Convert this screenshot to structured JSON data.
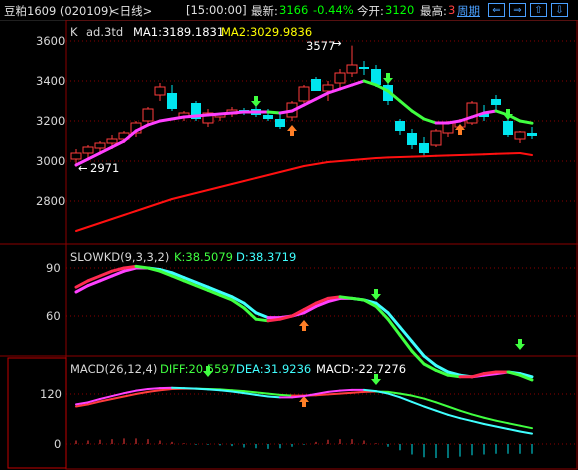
{
  "header": {
    "symbol": "豆粕1609 (020109)",
    "period_tag": "<日线>",
    "time": "[15:00:00]",
    "price_label": "最新:",
    "price": "3166",
    "change": "-0.44%",
    "open_label": "今开:",
    "open": "3120",
    "high_label": "最高:",
    "high": "3",
    "period_link": "周期",
    "nav_buttons": [
      "⇐",
      "⇒",
      "⇧",
      "⇩"
    ]
  },
  "main_panel": {
    "name": "K",
    "study": "ad.3td",
    "ma1_label": "MA1:3189.1831",
    "ma2_label": "MA2:3029.9836",
    "y_ticks": [
      "3600",
      "3400",
      "3200",
      "3000",
      "2800"
    ],
    "high_marker": "3577",
    "low_marker": "2971"
  },
  "kd_panel": {
    "title": "SLOWKD(9,3,3,2)",
    "k_label": "K:38.5079",
    "d_label": "D:38.3719",
    "y_ticks": [
      "90",
      "60"
    ]
  },
  "macd_panel": {
    "title": "MACD(26,12,4)",
    "diff_label": "DIFF:20.5597",
    "dea_label": "DEA:31.9236",
    "macd_label": "MACD:-22.7276",
    "y_ticks": [
      "120",
      "0"
    ]
  },
  "colors": {
    "up": "#ff3c3c",
    "down": "#00e5ee",
    "ma_up": "#ff40ff",
    "ma_down": "#40ff40",
    "ma_long": "#ff1010",
    "kd_k": "#ff2a50",
    "kd_d": "#40ffff",
    "grid": "#8b0000",
    "axis_text": "#d8d8d8"
  },
  "candles": [
    {
      "o": 3010,
      "h": 3060,
      "l": 2971,
      "c": 3040
    },
    {
      "o": 3040,
      "h": 3080,
      "l": 3010,
      "c": 3070
    },
    {
      "o": 3065,
      "h": 3100,
      "l": 3040,
      "c": 3090
    },
    {
      "o": 3090,
      "h": 3130,
      "l": 3060,
      "c": 3110
    },
    {
      "o": 3110,
      "h": 3150,
      "l": 3090,
      "c": 3140
    },
    {
      "o": 3140,
      "h": 3200,
      "l": 3120,
      "c": 3190
    },
    {
      "o": 3200,
      "h": 3270,
      "l": 3180,
      "c": 3260
    },
    {
      "o": 3330,
      "h": 3390,
      "l": 3300,
      "c": 3370
    },
    {
      "o": 3340,
      "h": 3380,
      "l": 3250,
      "c": 3260
    },
    {
      "o": 3220,
      "h": 3250,
      "l": 3200,
      "c": 3240
    },
    {
      "o": 3290,
      "h": 3300,
      "l": 3200,
      "c": 3210
    },
    {
      "o": 3190,
      "h": 3260,
      "l": 3170,
      "c": 3240
    },
    {
      "o": 3220,
      "h": 3240,
      "l": 3200,
      "c": 3235
    },
    {
      "o": 3235,
      "h": 3270,
      "l": 3220,
      "c": 3255
    },
    {
      "o": 3255,
      "h": 3265,
      "l": 3230,
      "c": 3240
    },
    {
      "o": 3260,
      "h": 3290,
      "l": 3220,
      "c": 3230
    },
    {
      "o": 3230,
      "h": 3260,
      "l": 3200,
      "c": 3210
    },
    {
      "o": 3210,
      "h": 3240,
      "l": 3160,
      "c": 3170
    },
    {
      "o": 3220,
      "h": 3300,
      "l": 3200,
      "c": 3290
    },
    {
      "o": 3300,
      "h": 3380,
      "l": 3290,
      "c": 3370
    },
    {
      "o": 3410,
      "h": 3420,
      "l": 3350,
      "c": 3350
    },
    {
      "o": 3350,
      "h": 3400,
      "l": 3300,
      "c": 3380
    },
    {
      "o": 3390,
      "h": 3460,
      "l": 3360,
      "c": 3440
    },
    {
      "o": 3440,
      "h": 3577,
      "l": 3420,
      "c": 3480
    },
    {
      "o": 3470,
      "h": 3500,
      "l": 3430,
      "c": 3460
    },
    {
      "o": 3460,
      "h": 3480,
      "l": 3370,
      "c": 3380
    },
    {
      "o": 3380,
      "h": 3400,
      "l": 3280,
      "c": 3300
    },
    {
      "o": 3200,
      "h": 3210,
      "l": 3130,
      "c": 3150
    },
    {
      "o": 3140,
      "h": 3160,
      "l": 3060,
      "c": 3080
    },
    {
      "o": 3090,
      "h": 3120,
      "l": 3020,
      "c": 3040
    },
    {
      "o": 3080,
      "h": 3160,
      "l": 3070,
      "c": 3150
    },
    {
      "o": 3140,
      "h": 3200,
      "l": 3120,
      "c": 3190
    },
    {
      "o": 3170,
      "h": 3210,
      "l": 3150,
      "c": 3200
    },
    {
      "o": 3190,
      "h": 3300,
      "l": 3180,
      "c": 3290
    },
    {
      "o": 3240,
      "h": 3280,
      "l": 3200,
      "c": 3220
    },
    {
      "o": 3310,
      "h": 3330,
      "l": 3250,
      "c": 3280
    },
    {
      "o": 3200,
      "h": 3230,
      "l": 3120,
      "c": 3130
    },
    {
      "o": 3110,
      "h": 3150,
      "l": 3090,
      "c": 3145
    },
    {
      "o": 3140,
      "h": 3170,
      "l": 3110,
      "c": 3125
    }
  ],
  "ma1": [
    2980,
    3010,
    3040,
    3070,
    3100,
    3150,
    3180,
    3200,
    3210,
    3220,
    3225,
    3230,
    3235,
    3240,
    3245,
    3245,
    3245,
    3240,
    3250,
    3280,
    3310,
    3340,
    3360,
    3380,
    3400,
    3380,
    3350,
    3300,
    3250,
    3210,
    3190,
    3190,
    3200,
    3220,
    3240,
    3250,
    3230,
    3200,
    3189
  ],
  "ma2": [
    2650,
    2670,
    2690,
    2710,
    2730,
    2750,
    2770,
    2790,
    2810,
    2825,
    2840,
    2855,
    2870,
    2885,
    2900,
    2915,
    2930,
    2945,
    2960,
    2975,
    2985,
    2995,
    3000,
    3005,
    3010,
    3015,
    3018,
    3020,
    3022,
    3024,
    3026,
    3028,
    3030,
    3032,
    3034,
    3036,
    3038,
    3040,
    3030
  ],
  "kd_k": [
    78,
    82,
    85,
    88,
    90,
    91,
    90,
    88,
    85,
    82,
    79,
    76,
    73,
    70,
    65,
    58,
    57,
    58,
    60,
    64,
    68,
    71,
    72,
    71,
    70,
    66,
    58,
    48,
    38,
    30,
    26,
    23,
    22,
    22,
    24,
    25,
    25,
    23,
    20
  ],
  "kd_d": [
    75,
    79,
    82,
    85,
    88,
    90,
    90,
    89,
    87,
    84,
    81,
    78,
    75,
    72,
    68,
    62,
    59,
    59,
    60,
    62,
    66,
    69,
    71,
    71,
    70,
    68,
    62,
    53,
    44,
    35,
    29,
    25,
    23,
    22,
    23,
    24,
    25,
    24,
    22
  ],
  "macd_diff": [
    95,
    100,
    108,
    115,
    122,
    128,
    132,
    134,
    135,
    134,
    133,
    131,
    129,
    126,
    122,
    118,
    114,
    112,
    112,
    115,
    120,
    125,
    128,
    130,
    130,
    127,
    121,
    112,
    101,
    90,
    80,
    70,
    62,
    55,
    48,
    42,
    36,
    30,
    25
  ],
  "macd_dea": [
    90,
    95,
    102,
    108,
    114,
    120,
    125,
    129,
    132,
    133,
    133,
    132,
    131,
    129,
    127,
    124,
    121,
    118,
    116,
    116,
    117,
    119,
    121,
    123,
    125,
    126,
    125,
    121,
    116,
    109,
    100,
    90,
    80,
    71,
    63,
    56,
    50,
    44,
    38
  ],
  "macd_hist": [
    10,
    10,
    12,
    14,
    16,
    16,
    14,
    10,
    6,
    2,
    -2,
    -2,
    -4,
    -6,
    -10,
    -12,
    -14,
    -12,
    -8,
    -2,
    6,
    12,
    14,
    14,
    10,
    2,
    -8,
    -18,
    -30,
    -38,
    -40,
    -40,
    -36,
    -32,
    -30,
    -28,
    -28,
    -28,
    -28
  ]
}
